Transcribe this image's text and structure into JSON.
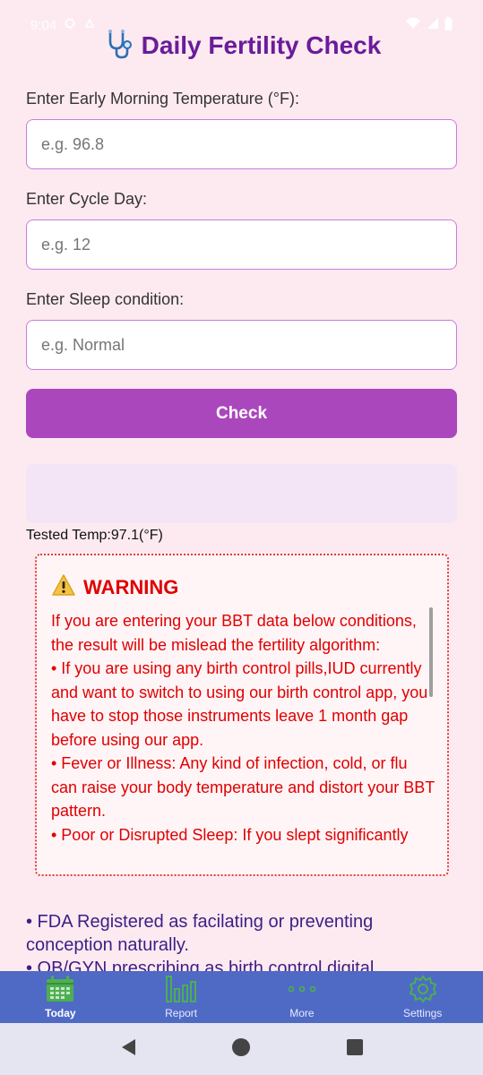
{
  "status_bar": {
    "time": "9:04"
  },
  "header": {
    "title": "Daily Fertility Check"
  },
  "form": {
    "temperature_label": "Enter Early Morning Temperature (°F):",
    "temperature_placeholder": "e.g. 96.8",
    "cycle_label": "Enter Cycle Day:",
    "cycle_placeholder": "e.g. 12",
    "sleep_label": "Enter Sleep condition:",
    "sleep_placeholder": "e.g. Normal",
    "check_label": "Check"
  },
  "result": {
    "tested_temp": "Tested Temp:97.1(°F)"
  },
  "warning": {
    "title": "WARNING",
    "intro": "If you are entering your BBT data below conditions, the result will be mislead the fertility algorithm:",
    "items": [
      "• If you are using any birth control pills,IUD currently and want to switch to using our birth control app, you have to stop those instruments leave 1 month gap before using our app.",
      "• Fever or Illness: Any kind of infection, cold, or flu can raise your body temperature and distort your BBT pattern.",
      "• Poor or Disrupted Sleep: If you slept significantly"
    ]
  },
  "info": {
    "items": [
      "• FDA Registered as facilating or preventing conception naturally.",
      "• OB/GYN prescribing as birth control digital"
    ]
  },
  "bottom_nav": {
    "items": [
      {
        "label": "Today",
        "icon": "calendar-icon"
      },
      {
        "label": "Report",
        "icon": "bar-chart-icon"
      },
      {
        "label": "More",
        "icon": "dots-icon"
      },
      {
        "label": "Settings",
        "icon": "gear-icon"
      }
    ],
    "active_color": "#4caf50"
  },
  "colors": {
    "accent": "#ab47bc",
    "title": "#6a1b9a",
    "warning": "#e00000",
    "nav_bar": "#4f6ac5"
  }
}
